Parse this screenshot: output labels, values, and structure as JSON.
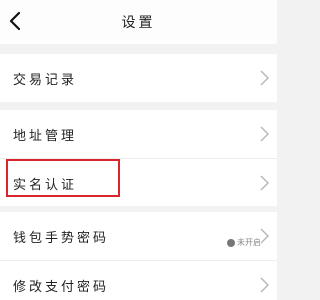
{
  "nav": {
    "back_icon": "chevron-left-icon",
    "title": "设置"
  },
  "groups": [
    {
      "items": [
        {
          "label": "交易记录"
        }
      ]
    },
    {
      "items": [
        {
          "label": "地址管理"
        },
        {
          "label": "实名认证",
          "highlighted": true
        }
      ]
    },
    {
      "items": [
        {
          "label": "钱包手势密码"
        },
        {
          "label": "修改支付密码"
        }
      ]
    }
  ],
  "watermark": {
    "text": "未开启"
  },
  "colors": {
    "background": "#f2f2f2",
    "card": "#ffffff",
    "chevron": "#b5b5b5",
    "highlight_box": "#d8262c"
  }
}
